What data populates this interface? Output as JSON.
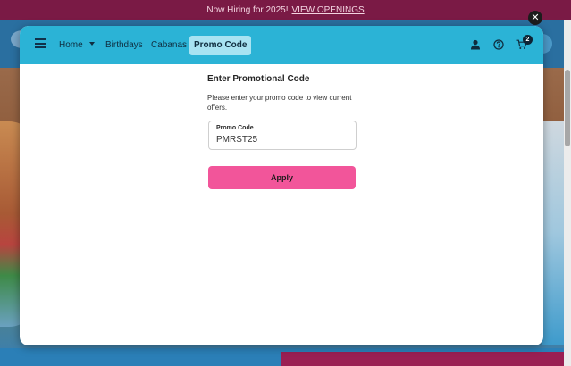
{
  "announcement": {
    "text": "Now Hiring for 2025!",
    "link": "VIEW OPENINGS"
  },
  "nav": {
    "items": [
      {
        "label": "Home"
      },
      {
        "label": "Birthdays"
      },
      {
        "label": "Cabanas"
      },
      {
        "label": "Promo Code"
      }
    ],
    "active": "Promo Code",
    "cart_count": "2",
    "icons": [
      "menu-icon",
      "user-icon",
      "help-icon",
      "cart-icon",
      "close-icon"
    ]
  },
  "promo": {
    "title": "Enter Promotional Code",
    "description": "Please enter your promo code to view current offers.",
    "field_label": "Promo Code",
    "field_value": "PMRST25",
    "apply_label": "Apply"
  },
  "colors": {
    "nav_bg": "#2bb3d6",
    "active_tab_bg": "#a8e3f2",
    "apply_bg": "#f2559a",
    "announce_bg": "#7a1a45"
  }
}
